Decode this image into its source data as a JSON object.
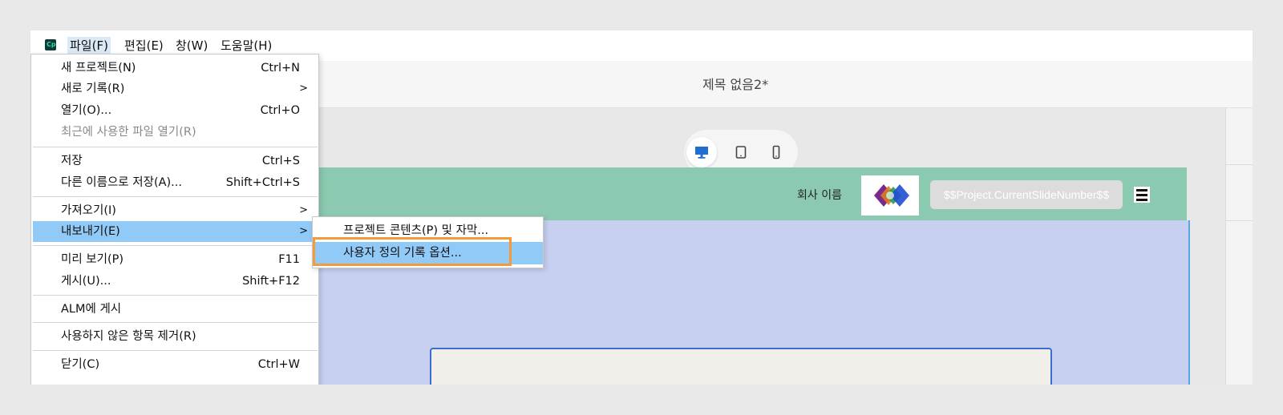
{
  "menubar": {
    "app_icon_text": "Cp",
    "file": "파일(F)",
    "edit": "편집(E)",
    "window": "창(W)",
    "help": "도움말(H)"
  },
  "document": {
    "title": "제목 없음2*"
  },
  "device_toggle": {
    "selected": "desktop",
    "icons": [
      "desktop-icon",
      "tablet-icon",
      "phone-icon"
    ]
  },
  "slide": {
    "company_name": "회사 이름",
    "slide_number": "$$Project.CurrentSlideNumber$$",
    "logo": "colored-diamonds-logo"
  },
  "file_menu": {
    "items": [
      {
        "label": "새 프로젝트(N)",
        "shortcut": "Ctrl+N",
        "submenu": false,
        "enabled": true
      },
      {
        "label": "새로 기록(R)",
        "shortcut": "",
        "submenu": true,
        "enabled": true
      },
      {
        "label": "열기(O)...",
        "shortcut": "Ctrl+O",
        "submenu": false,
        "enabled": true
      },
      {
        "label": "최근에 사용한 파일 열기(R)",
        "shortcut": "",
        "submenu": false,
        "enabled": false
      },
      {
        "label": "저장",
        "shortcut": "Ctrl+S",
        "submenu": false,
        "enabled": true
      },
      {
        "label": "다른 이름으로 저장(A)...",
        "shortcut": "Shift+Ctrl+S",
        "submenu": false,
        "enabled": true
      },
      {
        "label": "가져오기(I)",
        "shortcut": "",
        "submenu": true,
        "enabled": true
      },
      {
        "label": "내보내기(E)",
        "shortcut": "",
        "submenu": true,
        "enabled": true,
        "active": true
      },
      {
        "label": "미리 보기(P)",
        "shortcut": "F11",
        "submenu": false,
        "enabled": true
      },
      {
        "label": "게시(U)...",
        "shortcut": "Shift+F12",
        "submenu": false,
        "enabled": true
      },
      {
        "label": "ALM에 게시",
        "shortcut": "",
        "submenu": false,
        "enabled": true
      },
      {
        "label": "사용하지 않은 항목 제거(R)",
        "shortcut": "",
        "submenu": false,
        "enabled": true
      },
      {
        "label": "닫기(C)",
        "shortcut": "Ctrl+W",
        "submenu": false,
        "enabled": true
      }
    ],
    "submenu_arrow": ">"
  },
  "export_submenu": {
    "items": [
      {
        "label": "프로젝트 콘텐츠(P) 및 자막..."
      },
      {
        "label": "사용자 정의 기록 옵션...",
        "active": true
      }
    ]
  },
  "colors": {
    "menu_highlight": "#91c9f7",
    "callout_border": "#f29b3c",
    "slide_header": "#8bcab0",
    "slide_body": "#c8d0f2",
    "device_selected": "#1e6fd0"
  }
}
